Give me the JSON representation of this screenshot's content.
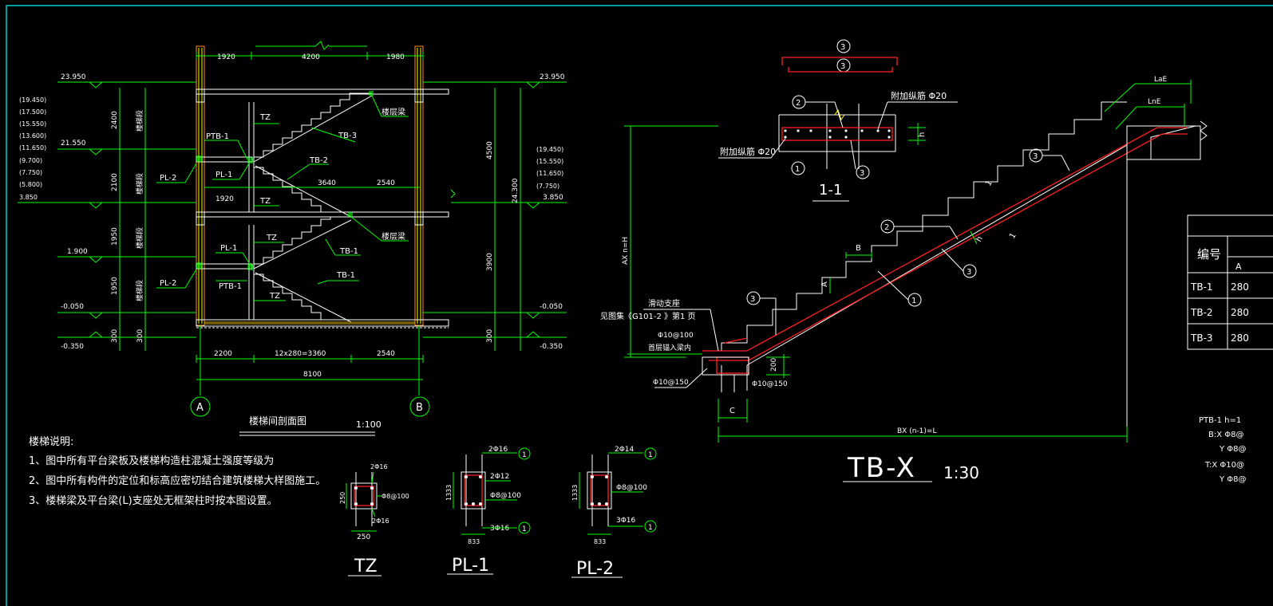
{
  "colors": {
    "background": "#000000",
    "line": "#ffffff",
    "dim": "#00ff00",
    "rebar": "#ff2020",
    "wall": "#ff8c1a",
    "frame": "#00cccc"
  },
  "section": {
    "top_dims": [
      "1920",
      "4200",
      "1980"
    ],
    "left_levels": [
      "23.950",
      "21.550",
      "1.900",
      "-0.050",
      "-0.350"
    ],
    "left_list": [
      "(19.450)",
      "(17.500)",
      "(15.550)",
      "(13.600)",
      "(11.650)",
      "(9.700)",
      "(7.750)",
      "(5.800)",
      "3.850"
    ],
    "left_vert_dims": [
      "2400",
      "2100",
      "1950",
      "1950",
      "300"
    ],
    "left_vert_notes": [
      "楼梯段",
      "楼梯段",
      "楼梯段",
      "楼梯段"
    ],
    "left_extra": "300",
    "right_levels": [
      "23.950",
      "3.850",
      "-0.050",
      "-0.350"
    ],
    "right_list": [
      "(19.450)",
      "(15.550)",
      "(11.650)",
      "(7.750)"
    ],
    "right_vert_dims": [
      "4500",
      "3900",
      "300",
      "24.300"
    ],
    "labels": {
      "ptb1_a": "PTB-1",
      "ptb1_b": "PTB-1",
      "tz_a": "TZ",
      "tz_b": "TZ",
      "tz_c": "TZ",
      "tz_d": "TZ",
      "tb3": "TB-3",
      "tb2": "TB-2",
      "tb1_a": "TB-1",
      "tb1_b": "TB-1",
      "pl2_a": "PL-2",
      "pl2_b": "PL-2",
      "pl1_a": "PL-1",
      "pl1_b": "PL-1",
      "beam_a": "楼层梁",
      "beam_b": "楼层梁"
    },
    "inner_dims": [
      "1920",
      "3640",
      "2540"
    ],
    "bottom_dims": [
      "2200",
      "12x280=3360",
      "2540"
    ],
    "total_dim": "8100",
    "axes": [
      "A",
      "B"
    ],
    "title": "楼梯间剖面图",
    "scale": "1:100"
  },
  "notes": {
    "heading": "楼梯说明:",
    "items": [
      "1、图中所有平台梁板及楼梯构造柱混凝土强度等级为",
      "2、图中所有构件的定位和标高应密切结合建筑楼梯大样图施工。",
      "3、楼梯梁及平台梁(L)支座处无框架柱时按本图设置。"
    ]
  },
  "tz": {
    "top": "2Φ16",
    "stir": "Φ8@100",
    "bottom": "2Φ16",
    "side": "250",
    "width": "250",
    "title": "TZ"
  },
  "pl1": {
    "top": "2Φ16",
    "mid": "2Φ12",
    "stir": "Φ8@100",
    "bottom": "3Φ16",
    "side": "1333",
    "width": "833",
    "title": "PL-1",
    "mark": "1"
  },
  "pl2": {
    "top": "2Φ14",
    "stir": "Φ8@100",
    "bottom": "3Φ16",
    "side": "1333",
    "width": "833",
    "title": "PL-2",
    "mark": "1"
  },
  "sec11": {
    "mark_top1": "3",
    "mark_top2": "3",
    "mark_2": "2",
    "mark_1": "1",
    "mark_3": "3",
    "add_top": "附加纵筋 Φ20",
    "add_bot": "附加纵筋 Φ20",
    "h": "h",
    "title": "1-1"
  },
  "tbx": {
    "lae": "LaE",
    "lne": "LnE",
    "marks": [
      "3",
      "2",
      "3",
      "1",
      "3"
    ],
    "b": "B",
    "a": "A",
    "slope1": "1",
    "slope2": "1",
    "h": "h",
    "ax": "AX n=H",
    "slide": "滑动支座",
    "atlas": "见图集《G101-2 》第1 页",
    "rebar1": "Φ10@100",
    "anchor": "首层锚入梁内",
    "rebar2": "Φ10@150",
    "rebar3": "Φ10@150",
    "d200": "200",
    "c": "C",
    "bx": "BX (n-1)=L",
    "title": "TB-X",
    "scale": "1:30"
  },
  "table": {
    "header": "编号",
    "col": "A",
    "rows": [
      {
        "id": "TB-1",
        "v": "280"
      },
      {
        "id": "TB-2",
        "v": "280"
      },
      {
        "id": "TB-3",
        "v": "280"
      }
    ]
  },
  "ptb": {
    "lines": [
      "PTB-1   h=1",
      "B:X  Φ8@",
      "Y Φ8@",
      "T:X  Φ10@",
      "Y Φ8@"
    ]
  }
}
